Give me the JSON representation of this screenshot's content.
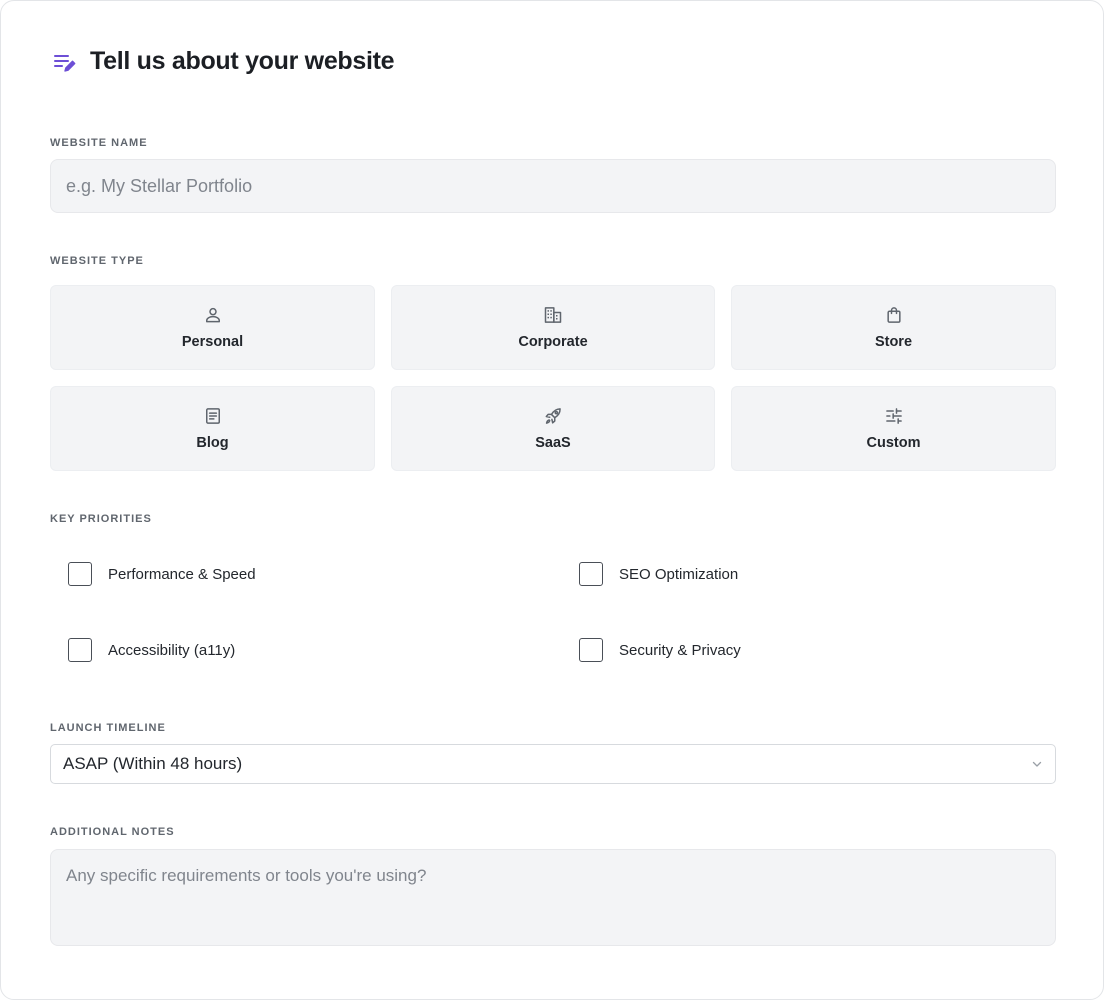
{
  "header": {
    "title": "Tell us about your website",
    "icon": "notes-edit-icon",
    "accent_color": "#6d4fd6"
  },
  "website_name": {
    "label": "WEBSITE NAME",
    "placeholder": "e.g. My Stellar Portfolio",
    "value": ""
  },
  "website_type": {
    "label": "WEBSITE TYPE",
    "options": [
      {
        "label": "Personal",
        "icon": "person-icon"
      },
      {
        "label": "Corporate",
        "icon": "building-icon"
      },
      {
        "label": "Store",
        "icon": "shopping-bag-icon"
      },
      {
        "label": "Blog",
        "icon": "article-icon"
      },
      {
        "label": "SaaS",
        "icon": "rocket-icon"
      },
      {
        "label": "Custom",
        "icon": "sliders-icon"
      }
    ]
  },
  "priorities": {
    "label": "KEY PRIORITIES",
    "items": [
      {
        "label": "Performance & Speed",
        "checked": false
      },
      {
        "label": "SEO Optimization",
        "checked": false
      },
      {
        "label": "Accessibility (a11y)",
        "checked": false
      },
      {
        "label": "Security & Privacy",
        "checked": false
      }
    ]
  },
  "timeline": {
    "label": "LAUNCH TIMELINE",
    "selected": "ASAP (Within 48 hours)"
  },
  "notes": {
    "label": "ADDITIONAL NOTES",
    "placeholder": "Any specific requirements or tools you're using?",
    "value": ""
  }
}
